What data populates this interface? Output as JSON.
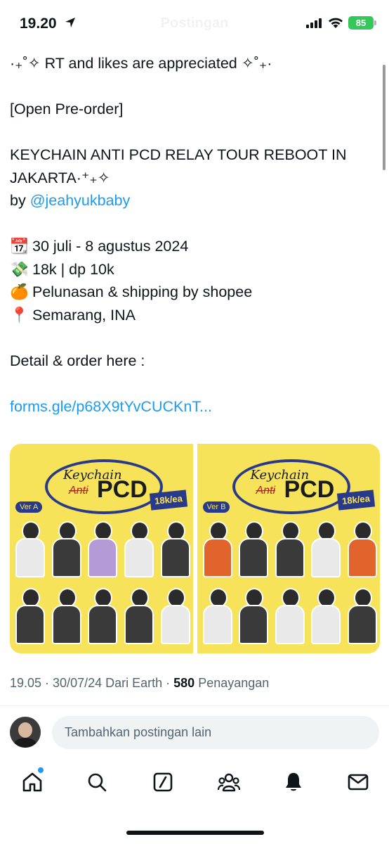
{
  "status_bar": {
    "time": "19.20",
    "title": "Postingan",
    "battery": "85"
  },
  "post": {
    "line1": "·₊˚✧ RT and likes are appreciated ✧˚₊·",
    "line2": "[Open Pre-order]",
    "line3": "KEYCHAIN ANTI PCD RELAY TOUR REBOOT IN JAKARTA·⁺₊✧",
    "by_prefix": "by ",
    "mention": "@jeahyukbaby",
    "date_emoji": "📆",
    "date": "30 juli - 8 agustus 2024",
    "price_emoji": "💸",
    "price": "18k | dp 10k",
    "ship_emoji": "🍊",
    "ship": "Pelunasan & shipping by shopee",
    "loc_emoji": "📍",
    "loc": "Semarang, INA",
    "detail": "Detail & order here :",
    "link": "forms.gle/p68X9tYvCUCKnT..."
  },
  "media": {
    "panels": [
      {
        "keychain": "Keychain",
        "anti": "Anti",
        "pcd": "PCD",
        "version": "Ver A",
        "price_tag": "18k/ea"
      },
      {
        "keychain": "Keychain",
        "anti": "Anti",
        "pcd": "PCD",
        "version": "Ver B",
        "price_tag": "18k/ea"
      }
    ]
  },
  "meta": {
    "time_date": "19.05 · 30/07/24 Dari Earth · ",
    "views": "580",
    "views_label": " Penayangan"
  },
  "reply": {
    "placeholder": "Tambahkan postingan lain"
  },
  "tabbar": {
    "items": [
      "home-icon",
      "search-icon",
      "grok-icon",
      "communities-icon",
      "notifications-icon",
      "messages-icon"
    ]
  },
  "colors": {
    "accent": "#1d9bf0",
    "battery": "#34c759",
    "media_bg": "#f7e35a"
  }
}
